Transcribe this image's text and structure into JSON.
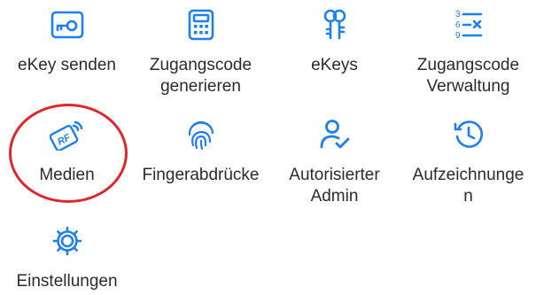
{
  "accent_color": "#1d7ff2",
  "highlight_color": "#e0262b",
  "menu": {
    "items": [
      {
        "label": "eKey senden",
        "icon": "send-ekey-icon"
      },
      {
        "label": "Zugangscode\ngenerieren",
        "icon": "calculator-icon"
      },
      {
        "label": "eKeys",
        "icon": "keys-icon"
      },
      {
        "label": "Zugangscode\nVerwaltung",
        "icon": "numbered-list-icon"
      },
      {
        "label": "Medien",
        "icon": "rf-card-icon",
        "highlighted": true
      },
      {
        "label": "Fingerabdrücke",
        "icon": "fingerprint-icon"
      },
      {
        "label": "Autorisierter\nAdmin",
        "icon": "admin-user-icon"
      },
      {
        "label": "Aufzeichnunge\nn",
        "icon": "history-clock-icon"
      },
      {
        "label": "Einstellungen",
        "icon": "gear-icon"
      }
    ]
  }
}
